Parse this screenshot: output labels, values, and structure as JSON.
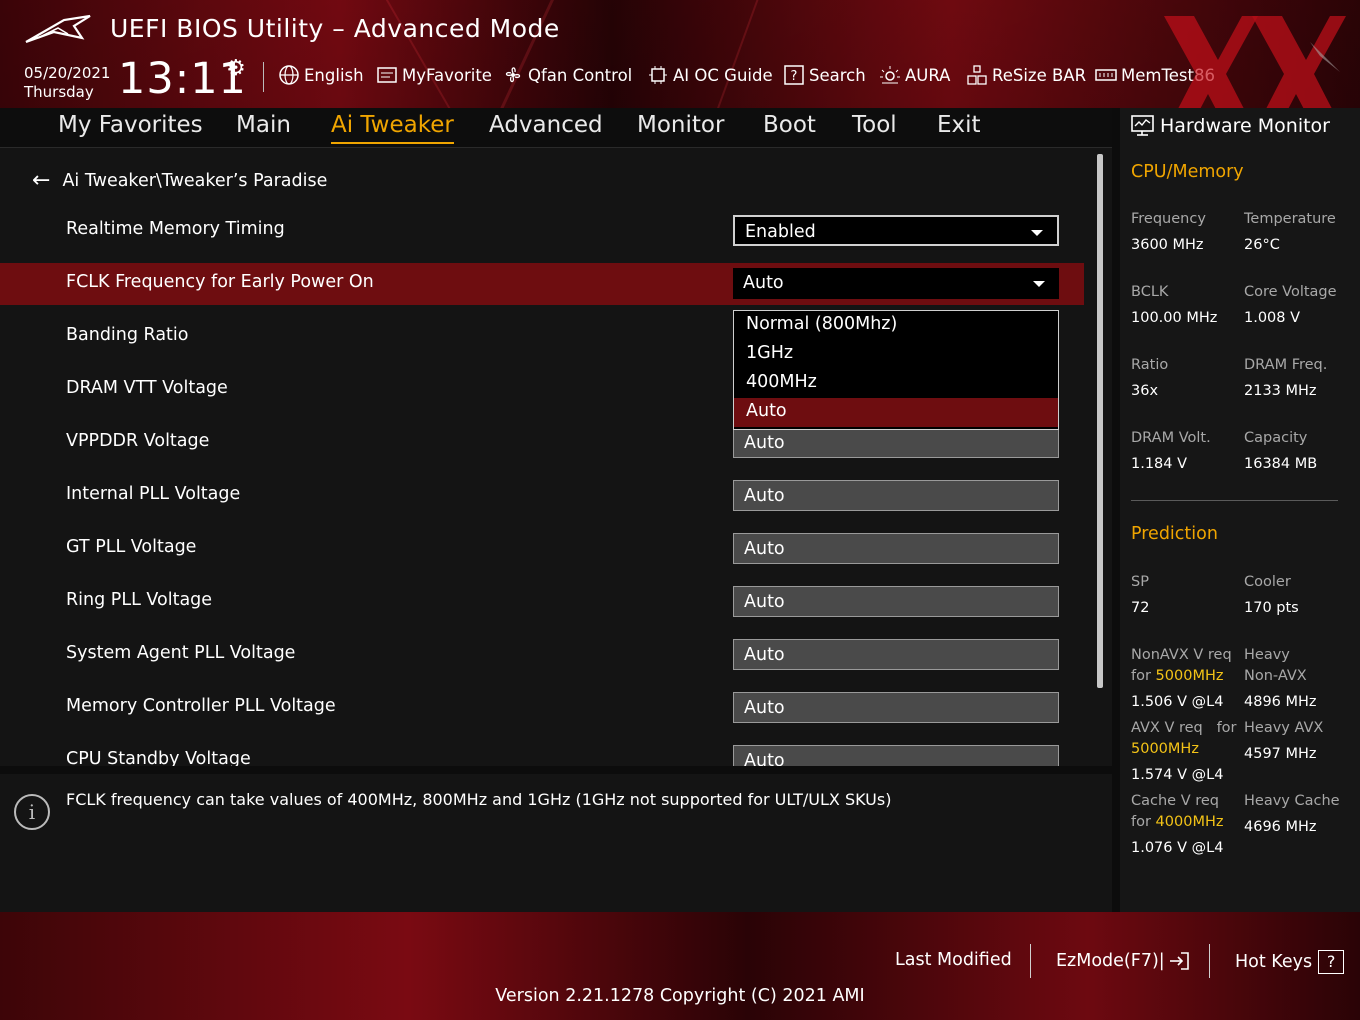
{
  "header": {
    "title": "UEFI BIOS Utility – Advanced Mode",
    "date": "05/20/2021",
    "day": "Thursday",
    "time": "13:11",
    "toolbar": [
      {
        "label": "English",
        "icon": "globe-icon"
      },
      {
        "label": "MyFavorite",
        "icon": "favorite-icon"
      },
      {
        "label": "Qfan Control",
        "icon": "fan-icon"
      },
      {
        "label": "AI OC Guide",
        "icon": "ai-chip-icon"
      },
      {
        "label": "Search",
        "icon": "search-help-icon"
      },
      {
        "label": "AURA",
        "icon": "aura-icon"
      },
      {
        "label": "ReSize BAR",
        "icon": "resize-bar-icon"
      },
      {
        "label": "MemTest86",
        "icon": "memtest-icon"
      }
    ]
  },
  "nav": {
    "tabs": [
      "My Favorites",
      "Main",
      "Ai Tweaker",
      "Advanced",
      "Monitor",
      "Boot",
      "Tool",
      "Exit"
    ],
    "active": "Ai Tweaker"
  },
  "main": {
    "breadcrumb": "Ai Tweaker\\Tweaker’s Paradise",
    "settings": [
      {
        "label": "Realtime Memory Timing",
        "value": "Enabled"
      },
      {
        "label": "FCLK Frequency for Early Power On",
        "value": "Auto"
      },
      {
        "label": "Banding Ratio",
        "value": ""
      },
      {
        "label": "DRAM VTT Voltage",
        "value": ""
      },
      {
        "label": "VPPDDR Voltage",
        "value": "Auto"
      },
      {
        "label": "Internal PLL Voltage",
        "value": "Auto"
      },
      {
        "label": "GT PLL Voltage",
        "value": "Auto"
      },
      {
        "label": "Ring PLL Voltage",
        "value": "Auto"
      },
      {
        "label": "System Agent PLL Voltage",
        "value": "Auto"
      },
      {
        "label": "Memory Controller PLL Voltage",
        "value": "Auto"
      },
      {
        "label": "CPU Standby Voltage",
        "value": "Auto"
      }
    ],
    "dropdown_options": [
      "Normal (800Mhz)",
      "1GHz",
      "400MHz",
      "Auto"
    ],
    "dropdown_selected": "Auto"
  },
  "help": {
    "text": "FCLK frequency can take values of 400MHz, 800MHz  and 1GHz (1GHz not supported for ULT/ULX SKUs)"
  },
  "hardware_monitor": {
    "title": "Hardware Monitor",
    "cpu_memory": {
      "heading": "CPU/Memory",
      "items": [
        {
          "label": "Frequency",
          "value": "3600 MHz"
        },
        {
          "label": "Temperature",
          "value": "26°C"
        },
        {
          "label": "BCLK",
          "value": "100.00 MHz"
        },
        {
          "label": "Core Voltage",
          "value": "1.008 V"
        },
        {
          "label": "Ratio",
          "value": "36x"
        },
        {
          "label": "DRAM Freq.",
          "value": "2133 MHz"
        },
        {
          "label": "DRAM Volt.",
          "value": "1.184 V"
        },
        {
          "label": "Capacity",
          "value": "16384 MB"
        }
      ]
    },
    "prediction": {
      "heading": "Prediction",
      "sp_label": "SP",
      "sp_value": "72",
      "cooler_label": "Cooler",
      "cooler_value": "170 pts",
      "nonavx_label_a": "NonAVX V req",
      "nonavx_label_for": "for",
      "nonavx_freq": "5000MHz",
      "nonavx_value": "1.506 V @L4",
      "heavy_nonavx_label_a": "Heavy",
      "heavy_nonavx_label_b": "Non-AVX",
      "heavy_nonavx_value": "4896 MHz",
      "avx_label_a": "AVX V req",
      "avx_label_for": "for",
      "avx_freq": "5000MHz",
      "avx_value": "1.574 V @L4",
      "heavy_avx_label": "Heavy AVX",
      "heavy_avx_value": "4597 MHz",
      "cache_label_a": "Cache V req",
      "cache_label_for": "for",
      "cache_freq": "4000MHz",
      "cache_value": "1.076 V @L4",
      "heavy_cache_label": "Heavy Cache",
      "heavy_cache_value": "4696 MHz"
    }
  },
  "footer": {
    "last_modified": "Last Modified",
    "ezmode": "EzMode(F7)|",
    "hotkeys": "Hot Keys",
    "hotkeys_key": "?",
    "version": "Version 2.21.1278 Copyright (C) 2021 AMI"
  },
  "colors": {
    "accent": "#f0a500",
    "highlight_yellow": "#f3c317",
    "selection_red": "#6e0d10",
    "brand_red": "#7a0a12"
  }
}
